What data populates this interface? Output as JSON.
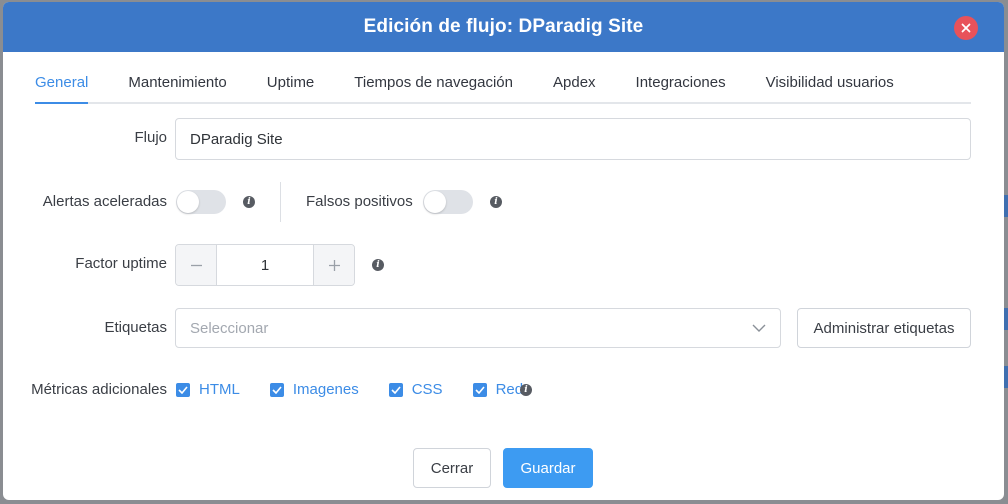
{
  "dialog": {
    "title": "Edición de flujo: DParadig Site"
  },
  "tabs": [
    {
      "label": "General",
      "active": true
    },
    {
      "label": "Mantenimiento",
      "active": false
    },
    {
      "label": "Uptime",
      "active": false
    },
    {
      "label": "Tiempos de navegación",
      "active": false
    },
    {
      "label": "Apdex",
      "active": false
    },
    {
      "label": "Integraciones",
      "active": false
    },
    {
      "label": "Visibilidad usuarios",
      "active": false
    }
  ],
  "form": {
    "flujo_label": "Flujo",
    "flujo_value": "DParadig Site",
    "alertas_label": "Alertas aceleradas",
    "alertas_on": false,
    "falsos_label": "Falsos positivos",
    "falsos_on": false,
    "factor_label": "Factor uptime",
    "factor_value": "1",
    "etiquetas_label": "Etiquetas",
    "etiquetas_placeholder": "Seleccionar",
    "administrar_label": "Administrar etiquetas",
    "metricas_label": "Métricas adicionales",
    "metricas": [
      {
        "label": "HTML",
        "checked": true
      },
      {
        "label": "Imagenes",
        "checked": true
      },
      {
        "label": "CSS",
        "checked": true
      },
      {
        "label": "Red",
        "checked": true
      }
    ]
  },
  "footer": {
    "cerrar_label": "Cerrar",
    "guardar_label": "Guardar"
  },
  "icons": {
    "info": "info-icon",
    "close": "close-icon",
    "chevron": "chevron-down-icon",
    "minus": "minus-icon",
    "plus": "plus-icon",
    "check": "check-icon"
  },
  "colors": {
    "header": "#3c78c8",
    "accent": "#3c8ce6",
    "primary_button": "#3d9bf2",
    "close_button": "#e8525a"
  }
}
